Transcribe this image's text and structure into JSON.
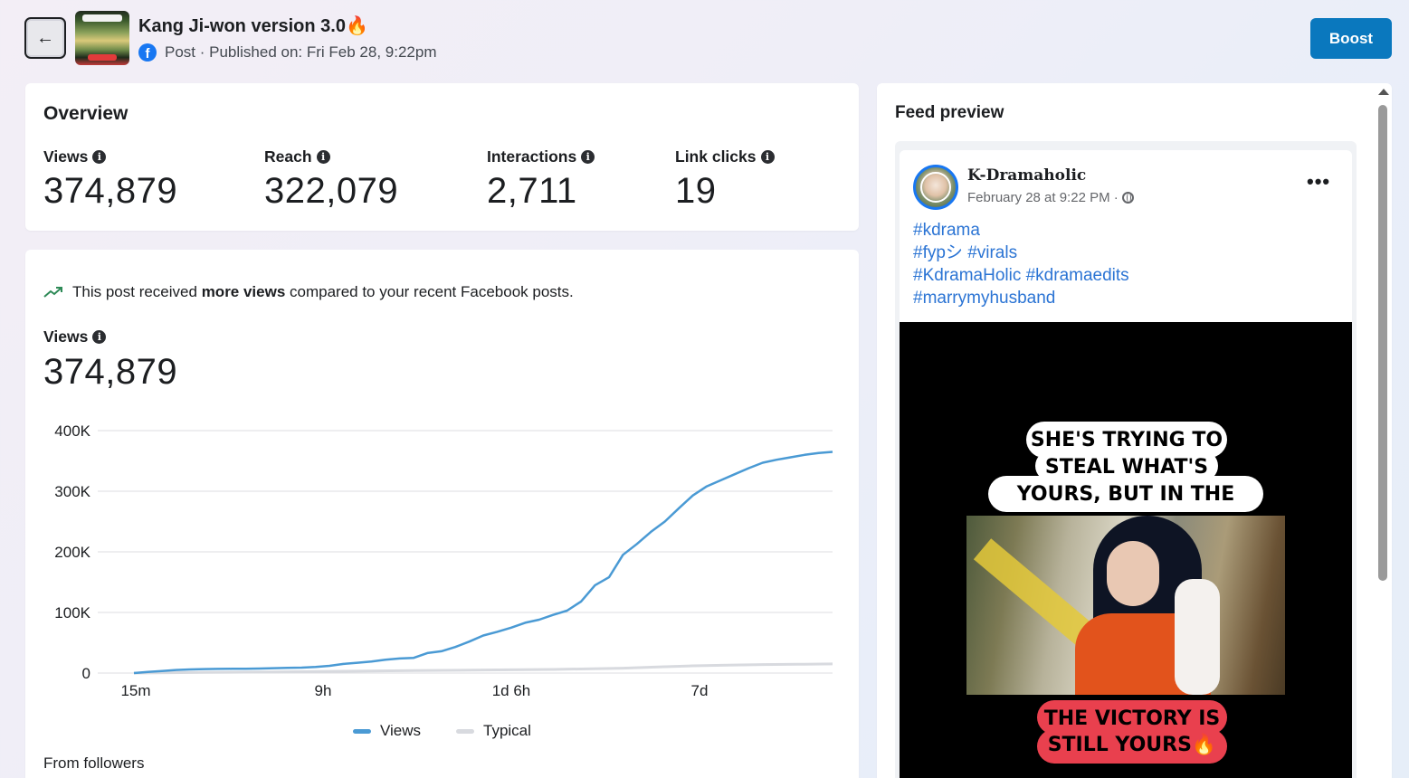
{
  "header": {
    "back_icon": "arrow-left-icon",
    "post_title": "Kang Ji-won version 3.0🔥",
    "platform_icon": "facebook-icon",
    "post_meta": "Post · Published on: Fri Feb 28, 9:22pm",
    "boost_label": "Boost"
  },
  "overview": {
    "title": "Overview",
    "metrics": [
      {
        "label": "Views",
        "value": "374,879"
      },
      {
        "label": "Reach",
        "value": "322,079"
      },
      {
        "label": "Interactions",
        "value": "2,711"
      },
      {
        "label": "Link clicks",
        "value": "19"
      }
    ]
  },
  "views_panel": {
    "trend_prefix": "This post received ",
    "trend_bold": "more views",
    "trend_suffix": " compared to your recent Facebook posts.",
    "views_label": "Views",
    "views_value": "374,879",
    "from_followers": "From followers"
  },
  "chart_data": {
    "type": "line",
    "x_ticks": [
      "15m",
      "9h",
      "1d 6h",
      "7d"
    ],
    "y_ticks": [
      "400K",
      "300K",
      "200K",
      "100K",
      "0"
    ],
    "ylim": [
      0,
      400000
    ],
    "legend_placement": "bottom-center",
    "grid": true,
    "series": [
      {
        "name": "Views",
        "color": "#4a9ad4",
        "x": [
          0,
          2,
          4,
          6,
          8,
          10,
          12,
          14,
          16,
          18,
          20,
          22,
          24,
          26,
          28,
          30,
          32,
          34,
          36,
          38,
          40,
          42,
          44,
          46,
          48,
          50,
          52,
          54,
          56,
          58,
          60,
          62,
          64,
          66,
          68,
          70,
          72,
          74,
          76,
          78,
          80,
          82,
          84,
          86,
          88,
          90,
          92,
          94,
          96,
          98,
          100
        ],
        "values": [
          0,
          2000,
          3500,
          5000,
          6000,
          6500,
          6800,
          7000,
          7200,
          7500,
          8000,
          8500,
          9000,
          10000,
          12000,
          15000,
          17000,
          19000,
          22000,
          24000,
          25000,
          33000,
          36000,
          43000,
          52000,
          62000,
          68000,
          75000,
          83000,
          88000,
          96000,
          103000,
          118000,
          145000,
          158000,
          195000,
          213000,
          233000,
          250000,
          272000,
          293000,
          308000,
          318000,
          328000,
          338000,
          347000,
          352000,
          356000,
          360000,
          363000,
          365000
        ]
      },
      {
        "name": "Typical",
        "color": "#d8dadf",
        "x": [
          0,
          10,
          20,
          30,
          40,
          50,
          60,
          70,
          75,
          80,
          85,
          90,
          95,
          100
        ],
        "values": [
          0,
          1000,
          2000,
          3000,
          4000,
          5000,
          6000,
          8000,
          10000,
          12000,
          13000,
          14000,
          14500,
          15000
        ]
      }
    ]
  },
  "feed_preview": {
    "title": "Feed preview",
    "page_name": "K-Dramaholic",
    "timestamp": "February 28 at 9:22 PM ·",
    "more_icon": "more-dots-icon",
    "hashtag_lines": [
      "#kdrama",
      "#fypシ #virals",
      "#KdramaHolic #kdramaedits",
      "#marrymyhusband"
    ],
    "caption_top": [
      "SHE'S TRYING TO",
      "STEAL WHAT'S",
      "YOURS, BUT IN THE END.."
    ],
    "caption_bottom": [
      "THE VICTORY IS",
      "STILL YOURS🔥"
    ]
  }
}
